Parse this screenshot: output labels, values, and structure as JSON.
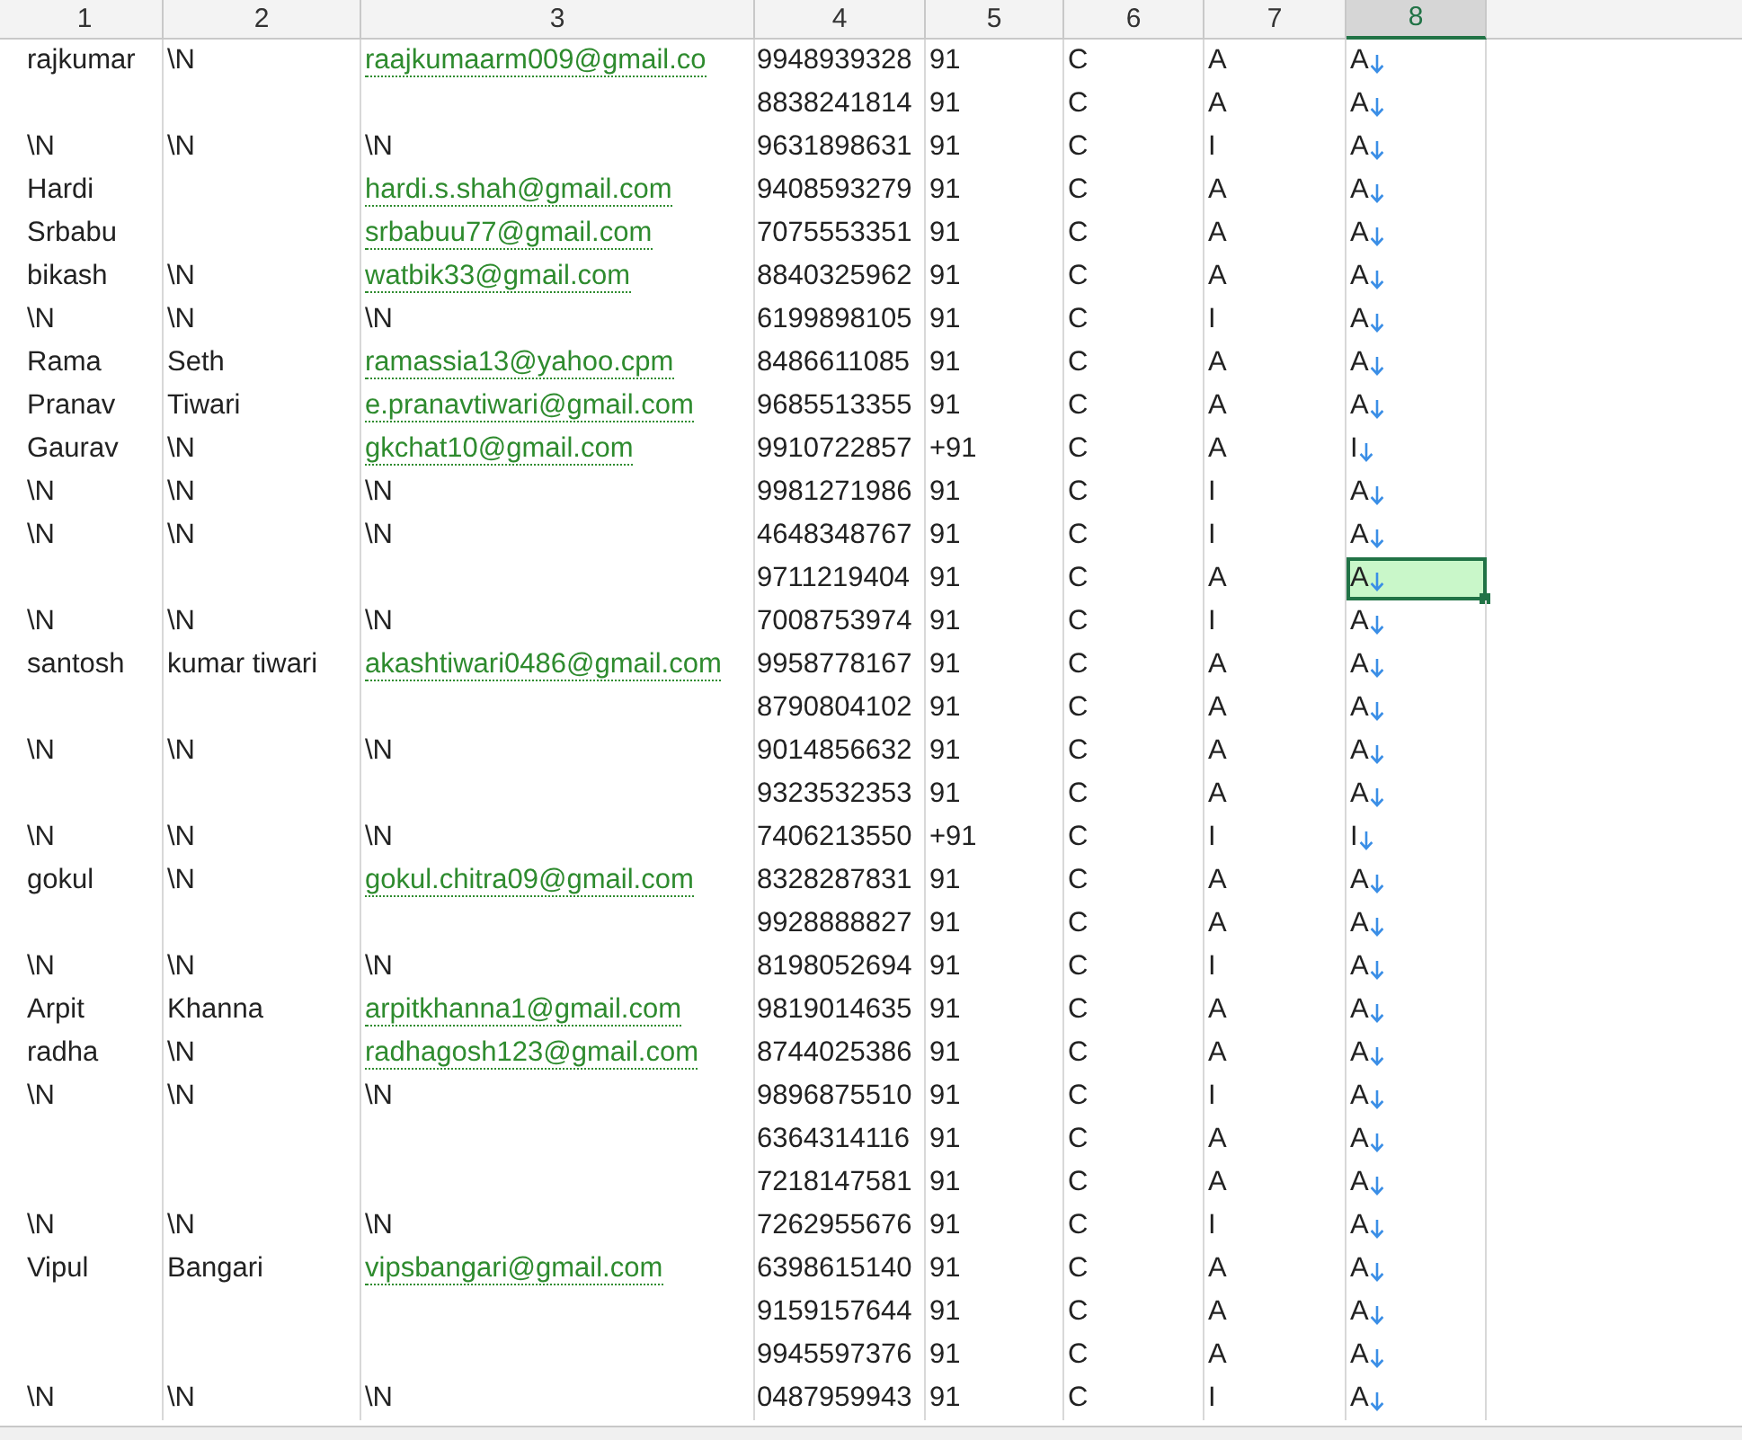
{
  "columns": [
    {
      "label": "1",
      "selected": false
    },
    {
      "label": "2",
      "selected": false
    },
    {
      "label": "3",
      "selected": false
    },
    {
      "label": "4",
      "selected": false
    },
    {
      "label": "5",
      "selected": false
    },
    {
      "label": "6",
      "selected": false
    },
    {
      "label": "7",
      "selected": false
    },
    {
      "label": "8",
      "selected": true
    }
  ],
  "rows": [
    {
      "cells": [
        "rajkumar",
        "\\N",
        "raajkumaarm009@gmail.co",
        "9948939328",
        "91",
        "C",
        "A",
        "A"
      ],
      "email_link": true,
      "selected": false
    },
    {
      "cells": [
        null,
        null,
        null,
        "8838241814",
        "91",
        "C",
        "A",
        "A"
      ],
      "email_link": false,
      "selected": false
    },
    {
      "cells": [
        "\\N",
        "\\N",
        "\\N",
        "9631898631",
        "91",
        "C",
        "I",
        "A"
      ],
      "email_link": false,
      "selected": false
    },
    {
      "cells": [
        "Hardi",
        null,
        "hardi.s.shah@gmail.com",
        "9408593279",
        "91",
        "C",
        "A",
        "A"
      ],
      "email_link": true,
      "selected": false
    },
    {
      "cells": [
        "Srbabu",
        null,
        "srbabuu77@gmail.com",
        "7075553351",
        "91",
        "C",
        "A",
        "A"
      ],
      "email_link": true,
      "selected": false
    },
    {
      "cells": [
        "bikash",
        "\\N",
        "watbik33@gmail.com",
        "8840325962",
        "91",
        "C",
        "A",
        "A"
      ],
      "email_link": true,
      "selected": false
    },
    {
      "cells": [
        "\\N",
        "\\N",
        "\\N",
        "6199898105",
        "91",
        "C",
        "I",
        "A"
      ],
      "email_link": false,
      "selected": false
    },
    {
      "cells": [
        "Rama",
        "Seth",
        "ramassia13@yahoo.cpm",
        "8486611085",
        "91",
        "C",
        "A",
        "A"
      ],
      "email_link": true,
      "selected": false
    },
    {
      "cells": [
        "Pranav",
        "Tiwari",
        "e.pranavtiwari@gmail.com",
        "9685513355",
        "91",
        "C",
        "A",
        "A"
      ],
      "email_link": true,
      "selected": false
    },
    {
      "cells": [
        "Gaurav",
        "\\N",
        "gkchat10@gmail.com",
        "9910722857",
        "+91",
        "C",
        "A",
        "I"
      ],
      "email_link": true,
      "selected": false
    },
    {
      "cells": [
        "\\N",
        "\\N",
        "\\N",
        "9981271986",
        "91",
        "C",
        "I",
        "A"
      ],
      "email_link": false,
      "selected": false
    },
    {
      "cells": [
        "\\N",
        "\\N",
        "\\N",
        "4648348767",
        "91",
        "C",
        "I",
        "A"
      ],
      "email_link": false,
      "selected": false
    },
    {
      "cells": [
        null,
        null,
        null,
        "9711219404",
        "91",
        "C",
        "A",
        "A"
      ],
      "email_link": false,
      "selected": true
    },
    {
      "cells": [
        "\\N",
        "\\N",
        "\\N",
        "7008753974",
        "91",
        "C",
        "I",
        "A"
      ],
      "email_link": false,
      "selected": false
    },
    {
      "cells": [
        "santosh",
        "kumar tiwari",
        "akashtiwari0486@gmail.com",
        "9958778167",
        "91",
        "C",
        "A",
        "A"
      ],
      "email_link": true,
      "selected": false
    },
    {
      "cells": [
        null,
        null,
        null,
        "8790804102",
        "91",
        "C",
        "A",
        "A"
      ],
      "email_link": false,
      "selected": false
    },
    {
      "cells": [
        "\\N",
        "\\N",
        "\\N",
        "9014856632",
        "91",
        "C",
        "A",
        "A"
      ],
      "email_link": false,
      "selected": false
    },
    {
      "cells": [
        null,
        null,
        null,
        "9323532353",
        "91",
        "C",
        "A",
        "A"
      ],
      "email_link": false,
      "selected": false
    },
    {
      "cells": [
        "\\N",
        "\\N",
        "\\N",
        "7406213550",
        "+91",
        "C",
        "I",
        "I"
      ],
      "email_link": false,
      "selected": false
    },
    {
      "cells": [
        "gokul",
        "\\N",
        "gokul.chitra09@gmail.com",
        "8328287831",
        "91",
        "C",
        "A",
        "A"
      ],
      "email_link": true,
      "selected": false
    },
    {
      "cells": [
        null,
        null,
        null,
        "9928888827",
        "91",
        "C",
        "A",
        "A"
      ],
      "email_link": false,
      "selected": false
    },
    {
      "cells": [
        "\\N",
        "\\N",
        "\\N",
        "8198052694",
        "91",
        "C",
        "I",
        "A"
      ],
      "email_link": false,
      "selected": false
    },
    {
      "cells": [
        "Arpit",
        "Khanna",
        "arpitkhanna1@gmail.com",
        "9819014635",
        "91",
        "C",
        "A",
        "A"
      ],
      "email_link": true,
      "selected": false
    },
    {
      "cells": [
        "radha",
        "\\N",
        "radhagosh123@gmail.com",
        "8744025386",
        "91",
        "C",
        "A",
        "A"
      ],
      "email_link": true,
      "selected": false
    },
    {
      "cells": [
        "\\N",
        "\\N",
        "\\N",
        "9896875510",
        "91",
        "C",
        "I",
        "A"
      ],
      "email_link": false,
      "selected": false
    },
    {
      "cells": [
        null,
        null,
        null,
        "6364314116",
        "91",
        "C",
        "A",
        "A"
      ],
      "email_link": false,
      "selected": false
    },
    {
      "cells": [
        null,
        null,
        null,
        "7218147581",
        "91",
        "C",
        "A",
        "A"
      ],
      "email_link": false,
      "selected": false
    },
    {
      "cells": [
        "\\N",
        "\\N",
        "\\N",
        "7262955676",
        "91",
        "C",
        "I",
        "A"
      ],
      "email_link": false,
      "selected": false
    },
    {
      "cells": [
        "Vipul",
        "Bangari",
        "vipsbangari@gmail.com",
        "6398615140",
        "91",
        "C",
        "A",
        "A"
      ],
      "email_link": true,
      "selected": false
    },
    {
      "cells": [
        null,
        null,
        null,
        "9159157644",
        "91",
        "C",
        "A",
        "A"
      ],
      "email_link": false,
      "selected": false
    },
    {
      "cells": [
        null,
        null,
        null,
        "9945597376",
        "91",
        "C",
        "A",
        "A"
      ],
      "email_link": false,
      "selected": false
    },
    {
      "cells": [
        "\\N",
        "\\N",
        "\\N",
        "0487959943",
        "91",
        "C",
        "I",
        "A"
      ],
      "email_link": false,
      "selected": false
    }
  ]
}
